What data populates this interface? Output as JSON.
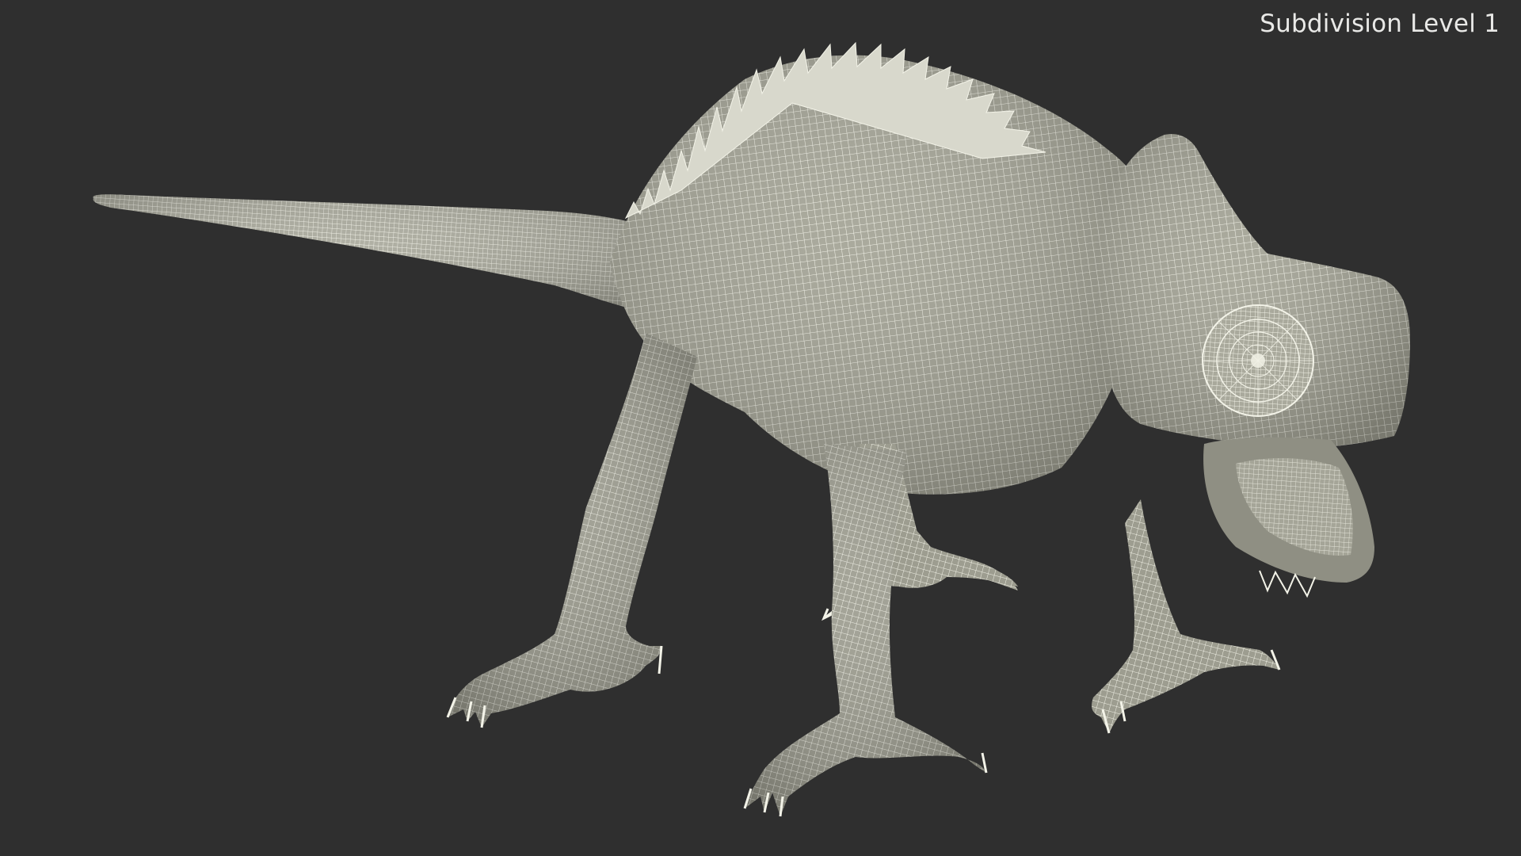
{
  "viewport": {
    "subdivision_label": "Subdivision Level 1",
    "background_color": "#2f2f2f",
    "mesh_fill_color": "#a3a395",
    "wire_color": "#f3f3e8"
  },
  "model": {
    "subject": "chameleon-wireframe-model",
    "parts": [
      "tail",
      "body",
      "dorsal-crest",
      "head-casque",
      "eye",
      "open-mouth",
      "front-left-leg",
      "front-right-leg",
      "hind-left-leg",
      "hind-right-leg"
    ]
  }
}
